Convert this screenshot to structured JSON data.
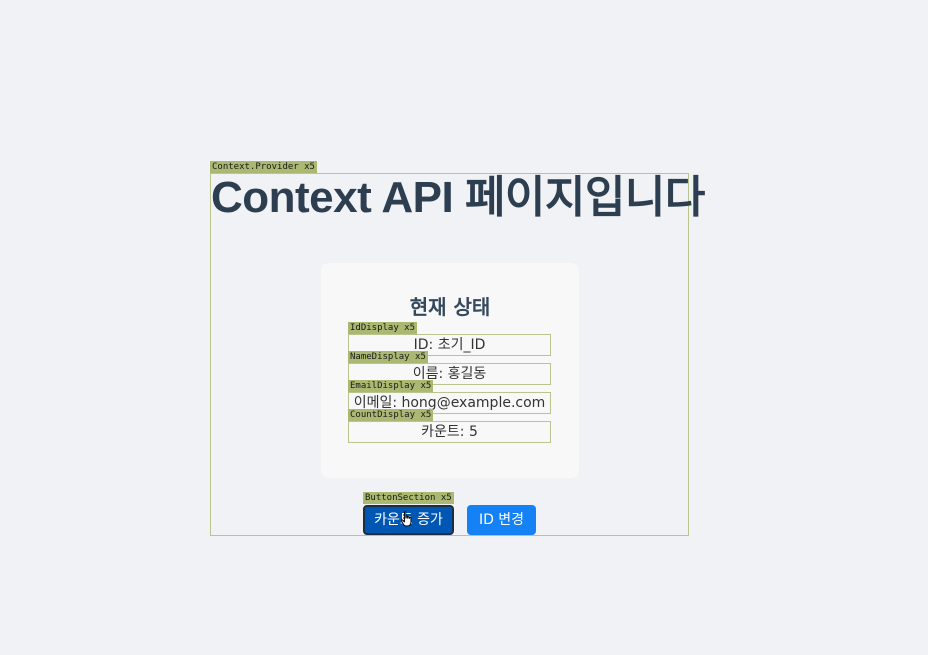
{
  "page": {
    "title": "Context API 페이지입니다"
  },
  "debug_labels": {
    "provider": "Context.Provider x5",
    "id_display": "IdDisplay x5",
    "name_display": "NameDisplay x5",
    "email_display": "EmailDisplay x5",
    "count_display": "CountDisplay x5",
    "button_section": "ButtonSection x5"
  },
  "state": {
    "heading": "현재 상태",
    "id_text": "ID: 초기_ID",
    "name_text": "이름: 홍길동",
    "email_text": "이메일: hong@example.com",
    "count_text": "카운트: 5"
  },
  "buttons": {
    "increment_label": "카운트 증가",
    "change_id_label": "ID 변경"
  },
  "colors": {
    "background": "#f0f2f5",
    "card": "#f8f8f8",
    "debug_outline": "#b9c48f",
    "debug_label_bg": "#aab872",
    "primary_button_active": "#0056b3",
    "primary_button": "#1481f5",
    "heading_text": "#2c3e50"
  },
  "icons": {
    "cursor": "hand-pointer-icon"
  }
}
